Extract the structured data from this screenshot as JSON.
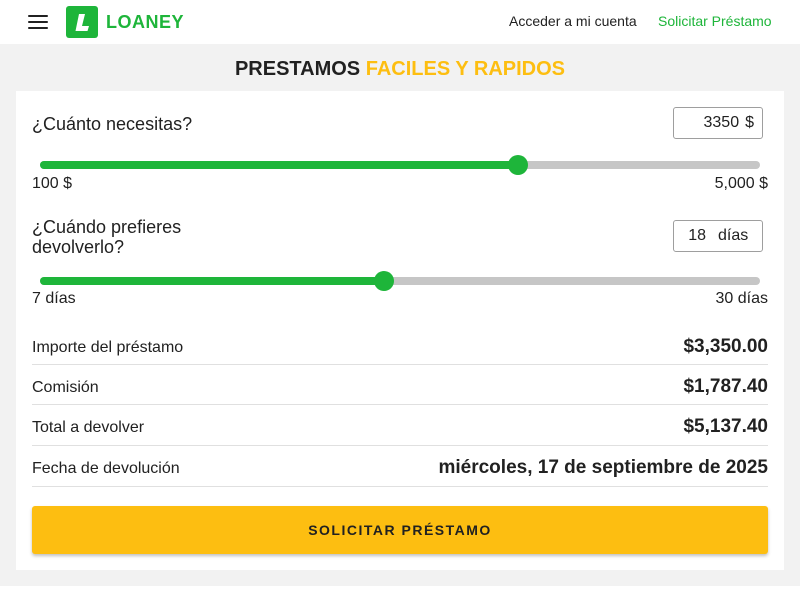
{
  "colors": {
    "brand_green": "#1eb53a",
    "accent_yellow": "#fdbe11",
    "track_gray": "#c6c6c6",
    "background_gray": "#f2f2f2"
  },
  "header": {
    "menu_icon": "hamburger-menu-icon",
    "logo_text": "LOANEY",
    "nav": {
      "account": "Acceder a mi cuenta",
      "apply": "Solicitar Préstamo"
    }
  },
  "title": {
    "part1": "PRESTAMOS",
    "part2": "FACILES Y RAPIDOS"
  },
  "amount": {
    "question": "¿Cuánto necesitas?",
    "value": "3350",
    "unit": "$",
    "min_label": "100 $",
    "max_label": "5,000 $",
    "min": 100,
    "max": 5000,
    "current": 3350
  },
  "days": {
    "question": "¿Cuándo prefieres devolverlo?",
    "value": "18",
    "unit": "días",
    "min_label": "7 días",
    "max_label": "30 días",
    "min": 7,
    "max": 30,
    "current": 18
  },
  "summary": {
    "loan_label": "Importe del préstamo",
    "loan_value": "$3,350.00",
    "fee_label": "Comisión",
    "fee_value": "$1,787.40",
    "total_label": "Total a devolver",
    "total_value": "$5,137.40",
    "date_label": "Fecha de devolución",
    "date_value": "miércoles, 17 de septiembre de 2025"
  },
  "cta_label": "SOLICITAR PRÉSTAMO"
}
